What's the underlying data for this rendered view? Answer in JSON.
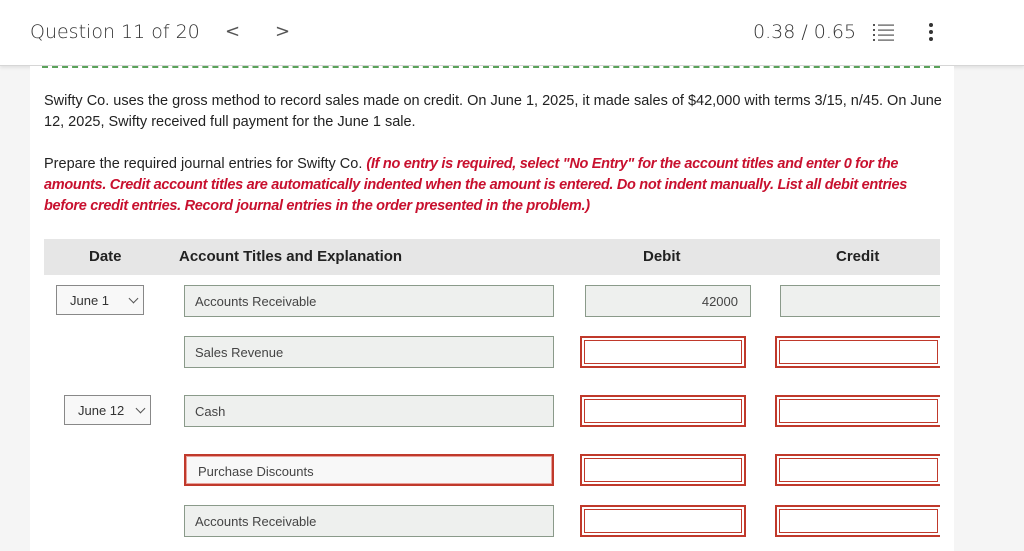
{
  "header": {
    "question_label": "Question 11 of 20",
    "prev": "<",
    "next": ">",
    "score": "0.38 / 0.65",
    "list_icon": "list-icon",
    "more_icon": "more-vertical-icon"
  },
  "problem": {
    "statement": "Swifty Co. uses the gross method to record sales made on credit. On June 1, 2025, it made sales of $42,000 with terms 3/15, n/45. On June 12, 2025, Swifty received full payment for the June 1 sale.",
    "prompt": "Prepare the required journal entries for Swifty Co.",
    "instructions": "(If no entry is required, select \"No Entry\" for the account titles and enter 0 for the amounts. Credit account titles are automatically indented when the amount is entered. Do not indent manually. List all debit entries before credit entries. Record journal entries in the order presented in the problem.)"
  },
  "table": {
    "headers": {
      "date": "Date",
      "account": "Account Titles and Explanation",
      "debit": "Debit",
      "credit": "Credit"
    },
    "rows": [
      {
        "date": "June 1",
        "account": "Accounts Receivable",
        "debit": "42000",
        "credit": ""
      },
      {
        "date": "",
        "account": "Sales Revenue",
        "debit": "",
        "credit": ""
      },
      {
        "date": "June 12",
        "account": "Cash",
        "debit": "",
        "credit": ""
      },
      {
        "date": "",
        "account": "Purchase Discounts",
        "debit": "",
        "credit": ""
      },
      {
        "date": "",
        "account": "Accounts Receivable",
        "debit": "",
        "credit": ""
      }
    ]
  },
  "colors": {
    "accent_red": "#c8102e",
    "input_error": "#c0392b",
    "dashed_green": "#5aa25a"
  }
}
